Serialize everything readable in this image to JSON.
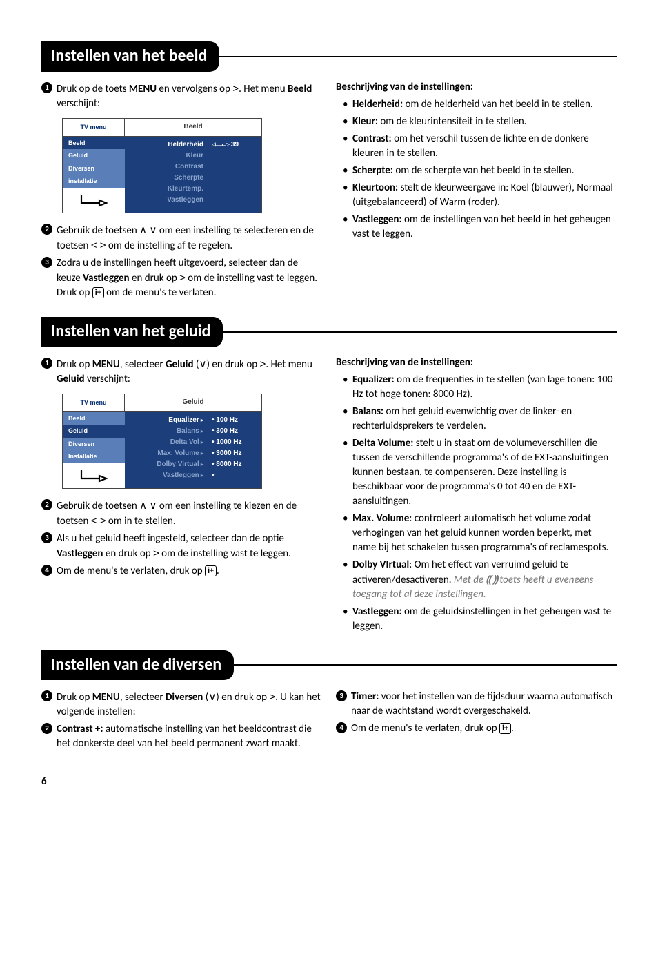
{
  "sections": {
    "beeld": {
      "title": "Instellen van het beeld",
      "steps": {
        "s1a": "Druk op de toets ",
        "s1b": "MENU",
        "s1c": " en vervolgens op ",
        "s1d": ". Het menu ",
        "s1e": "Beeld",
        "s1f": " verschijnt:",
        "s2a": "Gebruik de toetsen ",
        "s2b": " om een instelling te selecteren en de toetsen ",
        "s2c": " om de instelling af te regelen.",
        "s3a": "Zodra u de instellingen heeft uitgevoerd, selecteer dan de keuze ",
        "s3b": "Vastleggen",
        "s3c": " en druk op ",
        "s3d": " om de instelling vast te leggen.",
        "s3e": "Druk op ",
        "s3f": " om de menu's te verlaten."
      },
      "desc_title": "Beschrijving van de instellingen:",
      "desc": {
        "d1a": "Helderheid:",
        "d1b": " om de helderheid van het beeld in te stellen.",
        "d2a": "Kleur:",
        "d2b": " om de kleurintensiteit in te stellen.",
        "d3a": "Contrast:",
        "d3b": " om het verschil tussen de lichte en de donkere kleuren in te stellen.",
        "d4a": "Scherpte:",
        "d4b": " om de scherpte van het beeld in te stellen.",
        "d5a": "Kleurtoon:",
        "d5b": " stelt de kleurweergave in: Koel (blauwer), Normaal (uitgebalanceerd) of Warm (roder).",
        "d6a": "Vastleggen:",
        "d6b": " om de instellingen van het beeld in het geheugen vast te leggen."
      },
      "menu": {
        "side_top": "TV menu",
        "main_top": "Beeld",
        "side_items": [
          "Beeld",
          "Geluid",
          "Diversen",
          "installatie"
        ],
        "labels": [
          "Helderheid",
          "Kleur",
          "Contrast",
          "Scherpte",
          "Kleurtemp.",
          "Vastleggen"
        ],
        "value": "39"
      }
    },
    "geluid": {
      "title": "Instellen van het geluid",
      "steps": {
        "s1a": "Druk op ",
        "s1b": "MENU",
        "s1c": ", selecteer ",
        "s1d": "Geluid",
        "s1e": " (",
        "s1f": ") en druk op ",
        "s1g": ". Het menu ",
        "s1h": "Geluid",
        "s1i": " verschijnt:",
        "s2a": "Gebruik de toetsen ",
        "s2b": " om een instelling te kiezen en de toetsen ",
        "s2c": " om in te stellen.",
        "s3a": "Als u het geluid heeft ingesteld, selecteer dan de optie ",
        "s3b": "Vastleggen",
        "s3c": " en druk op ",
        "s3d": " om de instelling vast te leggen.",
        "s4a": "Om de menu's te verlaten, druk op ",
        "s4b": "."
      },
      "desc_title": "Beschrijving van de instellingen:",
      "desc": {
        "d1a": "Equalizer:",
        "d1b": " om de frequenties in te stellen (van lage tonen: 100 Hz tot hoge tonen: 8000 Hz).",
        "d2a": "Balans:",
        "d2b": " om het geluid evenwichtig over de linker- en rechterluidsprekers te verdelen.",
        "d3a": "Delta Volume:",
        "d3b": " stelt u in staat om de volumeverschillen die tussen de verschillende programma's of de EXT-aansluitingen kunnen bestaan, te compenseren. Deze instelling is beschikbaar voor de programma's 0 tot 40 en de EXT-aansluitingen.",
        "d4a": "Max. Volume",
        "d4b": ": controleert automatisch het volume zodat verhogingen van het geluid kunnen worden beperkt, met name bij het schakelen tussen programma's of reclamespots.",
        "d5a": "Dolby VIrtual",
        "d5b": ": Om het effect van verruimd geluid te activeren/desactiveren. ",
        "d5c": "Met de ",
        "d5d": " toets heeft u eveneens toegang tot al deze instellingen.",
        "d6a": "Vastleggen:",
        "d6b": " om de geluidsinstellingen in het geheugen vast te leggen."
      },
      "menu": {
        "side_top": "TV menu",
        "main_top": "Geluid",
        "side_items": [
          "Beeld",
          "Geluid",
          "Diversen",
          "Installatie"
        ],
        "labels": [
          "Equalizer",
          "Balans",
          "Delta Vol",
          "Max. Volume",
          "Dolby Virtual",
          "Vastleggen"
        ],
        "values": [
          "100 Hz",
          "300 Hz",
          "1000 Hz",
          "3000 Hz",
          "8000 Hz"
        ]
      }
    },
    "diversen": {
      "title": "Instellen van de diversen",
      "steps": {
        "s1a": "Druk op ",
        "s1b": "MENU",
        "s1c": ", selecteer ",
        "s1d": "Diversen",
        "s1e": " (",
        "s1f": ") en druk op ",
        "s1g": ". U kan het volgende instellen:",
        "s2a": "Contrast +:",
        "s2b": " automatische instelling van het beeldcontrast die het donkerste deel van het beeld permanent zwart maakt.",
        "s3a": "Timer:",
        "s3b": " voor het instellen van de tijdsduur waarna automatisch naar de wachtstand wordt overgeschakeld.",
        "s4a": "Om de menu's te verlaten, druk op ",
        "s4b": "."
      }
    }
  },
  "glyphs": {
    "right": ">",
    "updown_up": "∧",
    "updown_dn": "∨",
    "leftright": "< >",
    "iplus": "i+",
    "surround": "⸨ ⸩"
  },
  "pagenum": "6"
}
